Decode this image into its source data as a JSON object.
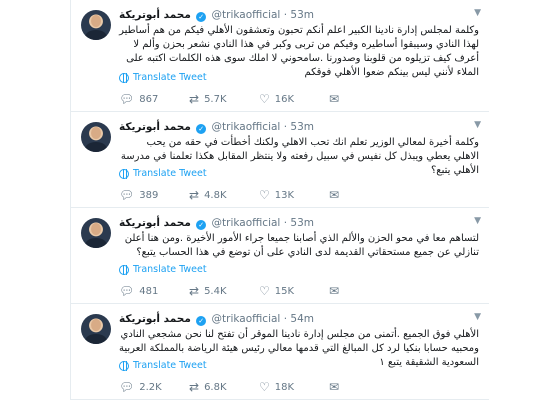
{
  "tweets": [
    {
      "name": "محمد أبوتريكة",
      "handle": "@trikaofficial",
      "time": "53m",
      "text": "وكلمة لمجلس إدارة نادينا الكبير اعلم أنكم تحبون وتعشقون الأهلي فيكم من هم أساطير لهذا النادي وسيبقوا أساطيره وفيكم من تربى وكبر في هذا النادي نشعر بحزن وألم لا أعرف كيف تزيلوه من قلوبنا وصدورنا .سامحوني لا املك سوى هذه الكلمات اكتبه على الملاء لأنني ليس بينكم ضعوا الأهلي فوقكم",
      "translate": "Translate Tweet",
      "replies": "867",
      "retweets": "5.7K",
      "likes": "16K"
    },
    {
      "name": "محمد أبوتريكة",
      "handle": "@trikaofficial",
      "time": "53m",
      "text": "وكلمة أخيرة لمعالي الوزير تعلم انك تحب الاهلي ولكنك أخطأت في حقه من يحب الاهلي يعطي ويبذل كل نفيس في سبيل رفعته ولا ينتظر المقابل هكذا تعلمنا في مدرسة الأهلي يتبع؟",
      "translate": "Translate Tweet",
      "replies": "389",
      "retweets": "4.8K",
      "likes": "13K"
    },
    {
      "name": "محمد أبوتريكة",
      "handle": "@trikaofficial",
      "time": "53m",
      "text": "لتساهم معا في محو الحزن والألم الذي أصابنا جميعا جراء الأمور الأخيرة .ومن هنا أعلن تنازلي عن جميع مستحقاتي القديمة لدى النادي على أن توضع في هذا الحساب يتبع؟",
      "translate": "Translate Tweet",
      "replies": "481",
      "retweets": "5.4K",
      "likes": "15K"
    },
    {
      "name": "محمد أبوتريكة",
      "handle": "@trikaofficial",
      "time": "54m",
      "text": "الأهلي فوق الجميع .أتمنى من مجلس إدارة نادينا الموقر أن تفتح لنا نحن مشجعي النادي ومحبيه حسابا بنكيا لرد كل المبالغ التي قدمها معالي رئيس هيئة الرياضة بالمملكة العربية السعودية الشقيقة يتبع ١",
      "translate": "Translate Tweet",
      "replies": "2.2K",
      "retweets": "6.8K",
      "likes": "18K"
    }
  ],
  "icons": {
    "reply": "reply-icon",
    "retweet": "retweet-icon",
    "like": "heart-icon",
    "dm": "envelope-icon",
    "more": "chevron-down-icon",
    "verified": "verified-badge-icon",
    "translate": "globe-icon"
  },
  "colors": {
    "accent": "#1da1f2",
    "muted": "#657786",
    "border": "#e6ecf0"
  }
}
